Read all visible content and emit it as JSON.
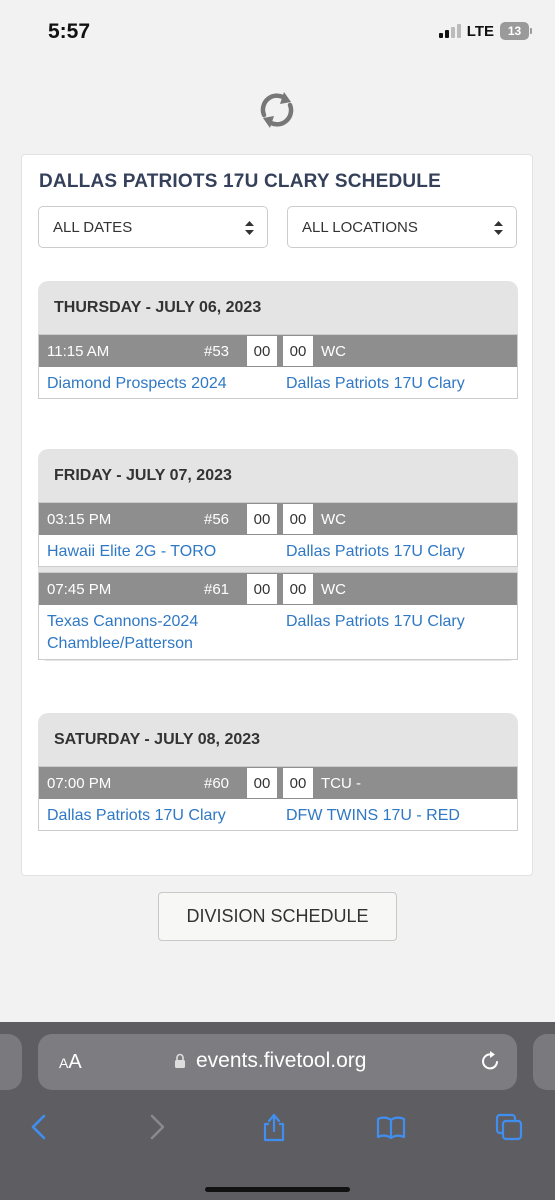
{
  "status_bar": {
    "time": "5:57",
    "network": "LTE",
    "battery": "13"
  },
  "page": {
    "title": "DALLAS PATRIOTS 17U CLARY SCHEDULE",
    "filters": {
      "dates": "ALL DATES",
      "locations": "ALL LOCATIONS"
    },
    "days": [
      {
        "label": "THURSDAY - JULY 06, 2023",
        "games": [
          {
            "time": "11:15 AM",
            "number": "#53",
            "score_away": "00",
            "score_home": "00",
            "location": "WC",
            "away": "Diamond Prospects 2024",
            "home": "Dallas Patriots 17U Clary"
          }
        ]
      },
      {
        "label": "FRIDAY - JULY 07, 2023",
        "games": [
          {
            "time": "03:15 PM",
            "number": "#56",
            "score_away": "00",
            "score_home": "00",
            "location": "WC",
            "away": "Hawaii Elite 2G - TORO",
            "home": "Dallas Patriots 17U Clary"
          },
          {
            "time": "07:45 PM",
            "number": "#61",
            "score_away": "00",
            "score_home": "00",
            "location": "WC",
            "away": "Texas Cannons-2024 Chamblee/Patterson",
            "home": "Dallas Patriots 17U Clary"
          }
        ]
      },
      {
        "label": "SATURDAY - JULY 08, 2023",
        "games": [
          {
            "time": "07:00 PM",
            "number": "#60",
            "score_away": "00",
            "score_home": "00",
            "location": "TCU -",
            "away": "Dallas Patriots 17U Clary",
            "home": "DFW TWINS 17U - RED"
          }
        ]
      }
    ],
    "division_button": "DIVISION SCHEDULE"
  },
  "browser": {
    "text_size_a_small": "A",
    "text_size_a_large": "A",
    "url": "events.fivetool.org"
  },
  "icons": {
    "refresh": "refresh-icon",
    "lock": "lock-icon",
    "reload": "reload-icon",
    "back": "chevron-left-icon",
    "forward": "chevron-right-icon",
    "share": "share-icon",
    "bookmarks": "book-icon",
    "tabs": "tabs-icon"
  },
  "colors": {
    "title": "#35405a",
    "link": "#2f78c4",
    "game_bar": "#8e8e8e",
    "day_panel": "#e4e4e4"
  }
}
